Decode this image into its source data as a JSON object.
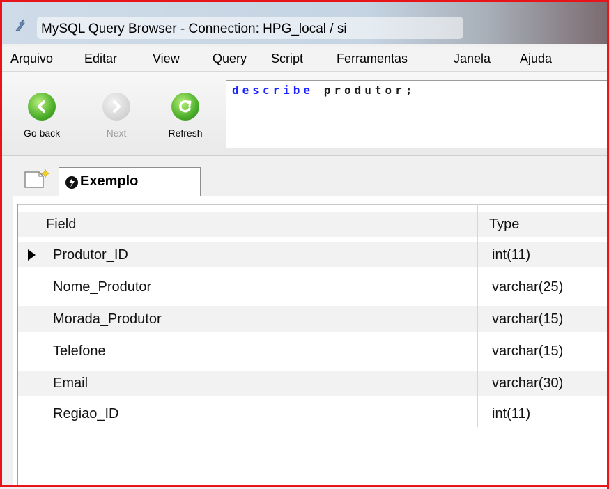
{
  "window": {
    "title": "MySQL Query Browser - Connection: HPG_local / si"
  },
  "menu": [
    "Arquivo",
    "Editar",
    "View",
    "Query",
    "Script",
    "Ferramentas",
    "Janela",
    "Ajuda"
  ],
  "toolbar": {
    "back_label": "Go back",
    "next_label": "Next",
    "refresh_label": "Refresh"
  },
  "query": {
    "keyword": "describe",
    "rest": "produtor;"
  },
  "tab": {
    "label": "Exemplo"
  },
  "grid": {
    "columns": [
      "Field",
      "Type"
    ],
    "rows": [
      {
        "field": "Produtor_ID",
        "type": "int(11)"
      },
      {
        "field": "Nome_Produtor",
        "type": "varchar(25)"
      },
      {
        "field": "Morada_Produtor",
        "type": "varchar(15)"
      },
      {
        "field": "Telefone",
        "type": "varchar(15)"
      },
      {
        "field": "Email",
        "type": "varchar(30)"
      },
      {
        "field": "Regiao_ID",
        "type": "int(11)"
      }
    ]
  },
  "colors": {
    "highlight_border": "#e8141a",
    "keyword": "#1b22ff",
    "nav_green": "#4caf2a",
    "row_alt": "#f2f2f2"
  }
}
